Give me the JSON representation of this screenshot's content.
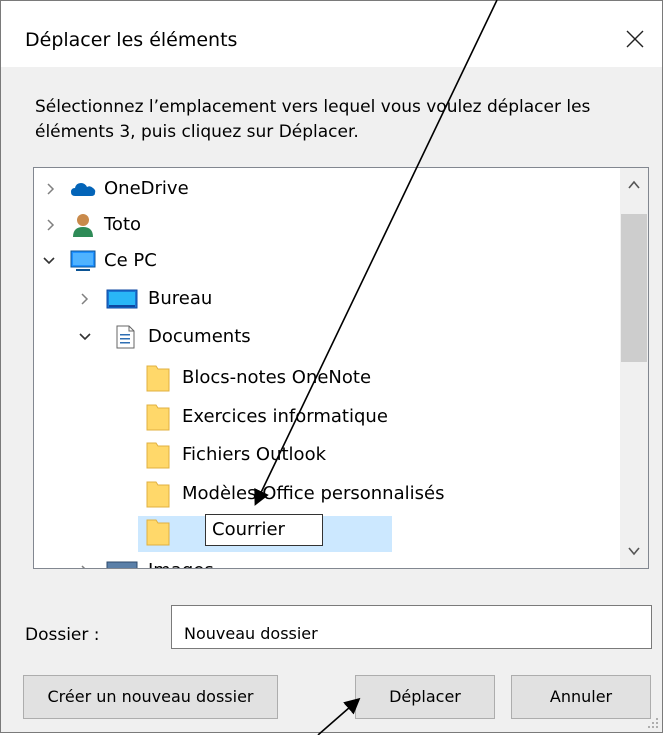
{
  "dialog": {
    "title": "Déplacer les éléments",
    "instruction": "Sélectionnez l’emplacement vers lequel vous voulez déplacer les éléments 3, puis cliquez sur Déplacer."
  },
  "tree": {
    "items": [
      {
        "label": "OneDrive",
        "icon": "onedrive-cloud-icon",
        "expanded": false,
        "level": 0
      },
      {
        "label": "Toto",
        "icon": "user-icon",
        "expanded": false,
        "level": 0
      },
      {
        "label": "Ce PC",
        "icon": "computer-icon",
        "expanded": true,
        "level": 0
      },
      {
        "label": "Bureau",
        "icon": "desktop-icon",
        "expanded": false,
        "level": 1
      },
      {
        "label": "Documents",
        "icon": "document-icon",
        "expanded": true,
        "level": 1
      },
      {
        "label": "Blocs-notes OneNote",
        "icon": "folder-icon",
        "level": 2
      },
      {
        "label": "Exercices informatique",
        "icon": "folder-icon",
        "level": 2
      },
      {
        "label": "Fichiers Outlook",
        "icon": "folder-icon",
        "level": 2
      },
      {
        "label": "Modèles Office personnalisés",
        "icon": "folder-icon",
        "level": 2
      },
      {
        "label": "Courrier",
        "icon": "folder-icon",
        "level": 2,
        "selected": true,
        "editing": true
      },
      {
        "label": "Images",
        "icon": "pictures-icon",
        "expanded": false,
        "level": 1
      }
    ]
  },
  "folder": {
    "label": "Dossier :",
    "value": "Nouveau dossier"
  },
  "buttons": {
    "new_folder": "Créer un nouveau dossier",
    "move": "Déplacer",
    "cancel": "Annuler"
  },
  "colors": {
    "selection": "#cce8ff",
    "onedrive": "#0364b8",
    "folder": "#ffd86a"
  }
}
